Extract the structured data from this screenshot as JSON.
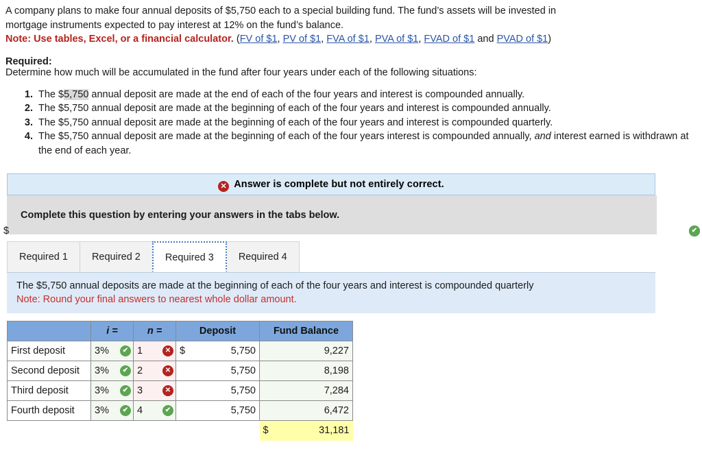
{
  "problem": {
    "line1": "A company plans to make four annual deposits of $5,750 each to a special building fund. The fund’s assets will be invested in",
    "line2": "mortgage instruments expected to pay interest at 12% on the fund’s balance.",
    "note_label": "Note: Use tables, Excel, or a financial calculator.",
    "links": [
      "FV of $1",
      "PV of $1",
      "FVA of $1",
      "PVA of $1",
      "FVAD of $1",
      "PVAD of $1"
    ],
    "links_conjunction": "and",
    "paren_open": "(",
    "paren_close": ")",
    "comma": ", "
  },
  "required": {
    "heading": "Required:",
    "subheading": "Determine how much will be accumulated in the fund after four years under each of the following situations:",
    "situations": [
      {
        "pre": "The $",
        "highlight": "5,750",
        "post": " annual deposit are made at the end of each of the four years  and interest is compounded annually."
      },
      {
        "text": "The $5,750 annual deposit are made at the beginning of each of the four years and interest is compounded annually."
      },
      {
        "text": "The $5,750 annual deposit are made at the beginning of each of the four years and interest is compounded quarterly."
      },
      {
        "pre": "The $5,750 annual deposit are made at the beginning of each of the four years interest is compounded annually, ",
        "italic": "and",
        "post": " interest earned is withdrawn at the end of each year."
      }
    ]
  },
  "status_banner": {
    "icon": "x-circle-icon",
    "icon_glyph": "✕",
    "text": "Answer is complete but not entirely correct."
  },
  "instruction_box": {
    "text": "Complete this question by entering your answers in the tabs below."
  },
  "tabs": {
    "items": [
      {
        "label": "Required 1",
        "active": false
      },
      {
        "label": "Required 2",
        "active": false
      },
      {
        "label": "Required 3",
        "active": true
      },
      {
        "label": "Required 4",
        "active": false
      }
    ]
  },
  "sub_instruction": {
    "line1": "The $5,750 annual deposits are made at the beginning of each of the four years and interest is compounded quarterly",
    "line2": "Note: Round your final answers to nearest whole dollar amount."
  },
  "answer_table": {
    "headers": [
      "",
      "i =",
      "n =",
      "Deposit",
      "Fund Balance"
    ],
    "rows": [
      {
        "label": "First deposit",
        "i": "3%",
        "i_mark": "correct",
        "n": "1",
        "n_mark": "incorrect",
        "deposit_symbol": "$",
        "deposit": "5,750",
        "balance_symbol": "$",
        "balance": "9,227",
        "balance_mark": "correct"
      },
      {
        "label": "Second deposit",
        "i": "3%",
        "i_mark": "correct",
        "n": "2",
        "n_mark": "incorrect",
        "deposit_symbol": "",
        "deposit": "5,750",
        "balance_symbol": "",
        "balance": "8,198",
        "balance_mark": "correct"
      },
      {
        "label": "Third deposit",
        "i": "3%",
        "i_mark": "correct",
        "n": "3",
        "n_mark": "incorrect",
        "deposit_symbol": "",
        "deposit": "5,750",
        "balance_symbol": "",
        "balance": "7,284",
        "balance_mark": "correct"
      },
      {
        "label": "Fourth deposit",
        "i": "3%",
        "i_mark": "correct",
        "n": "4",
        "n_mark": "correct",
        "deposit_symbol": "",
        "deposit": "5,750",
        "balance_symbol": "",
        "balance": "6,472",
        "balance_mark": "correct"
      }
    ],
    "total": {
      "symbol": "$",
      "value": "31,181"
    }
  },
  "icons": {
    "check_glyph": "✔",
    "x_glyph": "✕"
  },
  "colors": {
    "header_blue": "#7da7dc",
    "banner_blue": "#dcebf8",
    "instruction_gray": "#dedede",
    "note_red": "#b5231e",
    "link_blue": "#2b55a8",
    "correct_green": "#5ca551",
    "incorrect_red": "#b5231e",
    "total_yellow": "#ffffaa"
  }
}
